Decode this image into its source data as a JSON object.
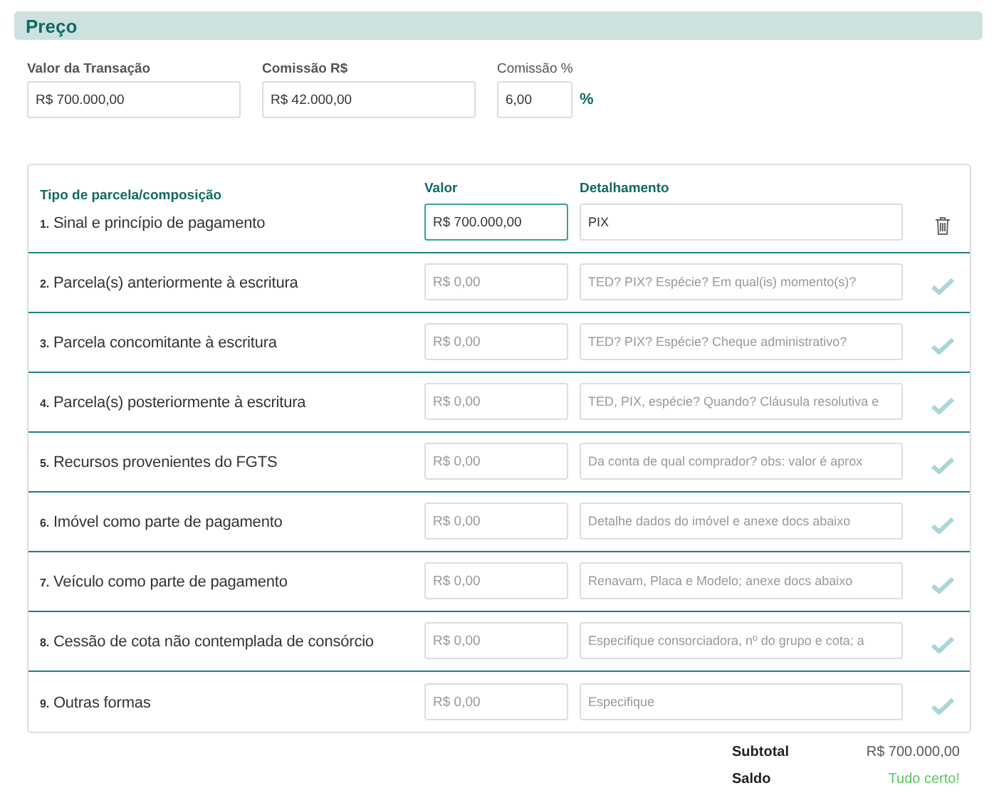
{
  "section": {
    "title": "Preço"
  },
  "fields": [
    {
      "label": "Valor da Transação",
      "value": "R$ 700.000,00",
      "bold": true
    },
    {
      "label": "Comissão R$",
      "value": "R$ 42.000,00",
      "bold": true
    },
    {
      "label": "Comissão %",
      "value": "6,00",
      "bold": false,
      "suffix": "%"
    }
  ],
  "table": {
    "columns": [
      "Tipo de parcela/composição",
      "Valor",
      "Detalhamento"
    ],
    "rows": [
      {
        "number": "1.",
        "label": "Sinal e princípio de pagamento",
        "value": "R$ 700.000,00",
        "detail": "PIX",
        "focused": true,
        "kind": "delete"
      },
      {
        "number": "2.",
        "label": "Parcela(s) anteriormente à escritura",
        "placeholder": "R$ 0,00",
        "detail_placeholder": "TED? PIX? Espécie? Em qual(is) momento(s)?",
        "focused": false,
        "kind": "check"
      },
      {
        "number": "3.",
        "label": "Parcela concomitante à escritura",
        "placeholder": "R$ 0,00",
        "detail_placeholder": "TED? PIX? Espécie? Cheque administrativo?",
        "focused": false,
        "kind": "check"
      },
      {
        "number": "4.",
        "label": "Parcela(s) posteriormente à escritura",
        "placeholder": "R$ 0,00",
        "detail_placeholder": "TED, PIX, espécie? Quando? Cláusula resolutiva e",
        "focused": false,
        "kind": "check"
      },
      {
        "number": "5.",
        "label": "Recursos provenientes do FGTS",
        "placeholder": "R$ 0,00",
        "detail_placeholder": "Da conta de qual comprador? obs: valor é aprox",
        "focused": false,
        "kind": "check"
      },
      {
        "number": "6.",
        "label": "Imóvel como parte de pagamento",
        "placeholder": "R$ 0,00",
        "detail_placeholder": "Detalhe dados do imóvel e anexe docs abaixo",
        "focused": false,
        "kind": "check"
      },
      {
        "number": "7.",
        "label": "Veículo como parte de pagamento",
        "placeholder": "R$ 0,00",
        "detail_placeholder": "Renavam, Placa e Modelo; anexe docs abaixo",
        "focused": false,
        "kind": "check"
      },
      {
        "number": "8.",
        "label": "Cessão de cota não contemplada de consórcio",
        "placeholder": "R$ 0,00",
        "detail_placeholder": "Especifique consorciadora, nº do grupo e cota; a",
        "focused": false,
        "kind": "check"
      },
      {
        "number": "9.",
        "label": "Outras formas",
        "placeholder": "R$ 0,00",
        "detail_placeholder": "Especifique",
        "focused": false,
        "kind": "check"
      }
    ]
  },
  "totals": [
    {
      "label": "Subtotal",
      "value": "R$ 700.000,00",
      "kind": "amount"
    },
    {
      "label": "Saldo",
      "value": "Tudo certo!",
      "kind": "ok"
    }
  ]
}
